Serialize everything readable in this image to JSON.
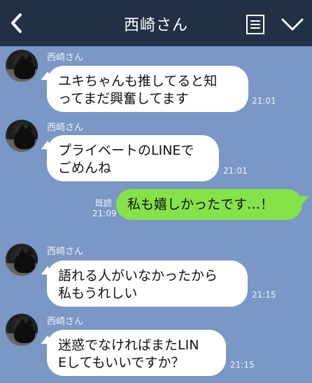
{
  "header": {
    "title": "西崎さん"
  },
  "messages": [
    {
      "sender": "西崎さん",
      "lines": [
        "ユキちゃんも推してると知",
        "ってまだ興奮してます"
      ],
      "time": "21:01"
    },
    {
      "sender": "西崎さん",
      "lines": [
        "プライベートのLINEで",
        "ごめんね"
      ],
      "time": "21:01"
    },
    {
      "lines": [
        "私も嬉しかったです…！"
      ],
      "read_label": "既読",
      "time": "21:09"
    },
    {
      "sender": "西崎さん",
      "lines": [
        "語れる人がいなかったから",
        "私もうれしい"
      ],
      "time": "21:15"
    },
    {
      "sender": "西崎さん",
      "lines": [
        "迷惑でなければまたLIN",
        "Eしてもいいですか？"
      ],
      "time": "21:15"
    }
  ],
  "colors": {
    "header_bg": "#223046",
    "chat_bg": "#7a97c5",
    "sent_bubble": "#85e249",
    "received_bubble": "#ffffff"
  },
  "icons": {
    "back": "chevron-left-icon",
    "memo": "note-icon",
    "menu": "chevron-down-icon"
  }
}
